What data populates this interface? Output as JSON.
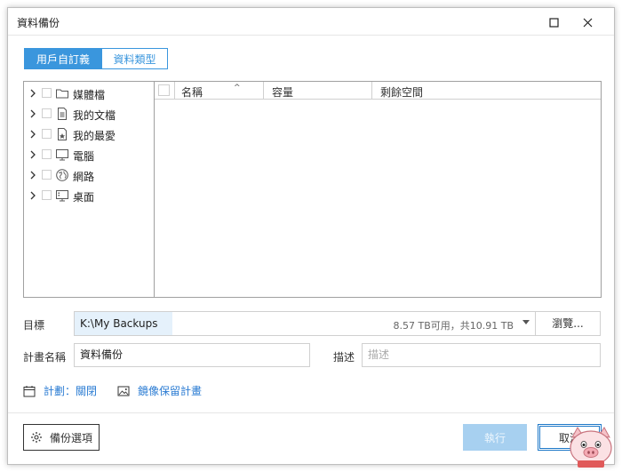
{
  "window": {
    "title": "資料備份"
  },
  "tabs": [
    {
      "label": "用戶自訂義",
      "active": true
    },
    {
      "label": "資料類型",
      "active": false
    }
  ],
  "tree": [
    {
      "label": "媒體檔",
      "icon": "folder-icon"
    },
    {
      "label": "我的文檔",
      "icon": "document-icon"
    },
    {
      "label": "我的最愛",
      "icon": "favorites-icon"
    },
    {
      "label": "電腦",
      "icon": "monitor-icon"
    },
    {
      "label": "網路",
      "icon": "network-icon"
    },
    {
      "label": "桌面",
      "icon": "desktop-icon"
    }
  ],
  "grid": {
    "columns": [
      "名稱",
      "容量",
      "剩餘空間"
    ],
    "sort_indicator": "^"
  },
  "destination": {
    "label": "目標",
    "path": "K:\\My Backups",
    "space": "8.57 TB可用，共10.91 TB",
    "browse_label": "瀏覽..."
  },
  "plan": {
    "name_label": "計畫名稱",
    "name_value": "資料備份",
    "desc_label": "描述",
    "desc_placeholder": "描述"
  },
  "links": {
    "schedule": "計劃：關閉",
    "retention": "鏡像保留計畫"
  },
  "footer": {
    "options_label": "備份選項",
    "run_label": "執行",
    "cancel_label": "取消"
  },
  "colors": {
    "accent": "#3a96dd",
    "link": "#2b7cd3",
    "run_disabled": "#a7d0f0"
  }
}
